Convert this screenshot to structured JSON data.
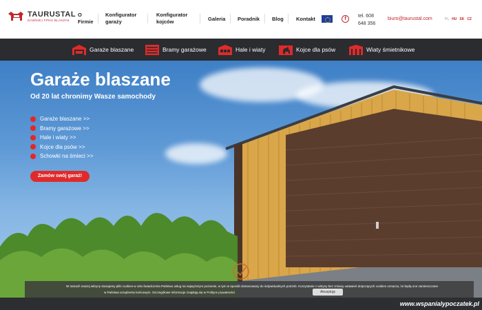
{
  "brand": {
    "name": "TAURUSTAL",
    "tagline": "DAWNIEJ FPHU BLASZAK"
  },
  "nav": {
    "items": [
      {
        "line1": "O",
        "line2": "Firmie"
      },
      {
        "line1": "Konfigurator",
        "line2": "garaży"
      },
      {
        "line1": "Konfigurator",
        "line2": "kojców"
      },
      {
        "line1": "Galeria",
        "line2": ""
      },
      {
        "line1": "Poradnik",
        "line2": ""
      },
      {
        "line1": "Blog",
        "line2": ""
      },
      {
        "line1": "Kontakt",
        "line2": ""
      }
    ],
    "phone_line1": "tel. 608",
    "phone_line2": "648 356",
    "email": "biuro@taurustal.com",
    "languages": [
      "PL",
      "HU",
      "SK",
      "CZ"
    ]
  },
  "categories": [
    {
      "label": "Garaże blaszane",
      "icon": "garage-icon"
    },
    {
      "label": "Bramy garażowe",
      "icon": "gate-icon"
    },
    {
      "label": "Hale i wiaty",
      "icon": "hall-icon"
    },
    {
      "label": "Kojce dla psów",
      "icon": "dog-kennel-icon"
    },
    {
      "label": "Wiaty śmietnikowe",
      "icon": "bin-shelter-icon"
    }
  ],
  "hero": {
    "title": "Garaże blaszane",
    "subtitle": "Od 20 lat chronimy Wasze samochody",
    "links": [
      "Garaże blaszane >>",
      "Bramy garażowe >>",
      "Hale i wiaty >>",
      "Kojce dla psów >>",
      "Schowki na śmieci >>"
    ],
    "cta": "Zamów swój garaż!"
  },
  "cookie": {
    "line1": "W ramach naszej witryny stosujemy pliki cookies w celu świadczenia Państwu usług na najwyższym poziomie, w tym w sposób dostosowany do indywidualnych potrzeb. Korzystanie z witryny bez zmiany ustawień dotyczących cookies oznacza, że będą one zamieszczane",
    "line2": "w Państwa urządzeniu końcowym. Szczegółowe informacje znajdują się w Polityce prywatności",
    "accept": "Akceptuję"
  },
  "watermark": "www.wspanialypoczatek.pl",
  "colors": {
    "accent": "#e02a2a",
    "dark_bar": "#2a2c30"
  }
}
